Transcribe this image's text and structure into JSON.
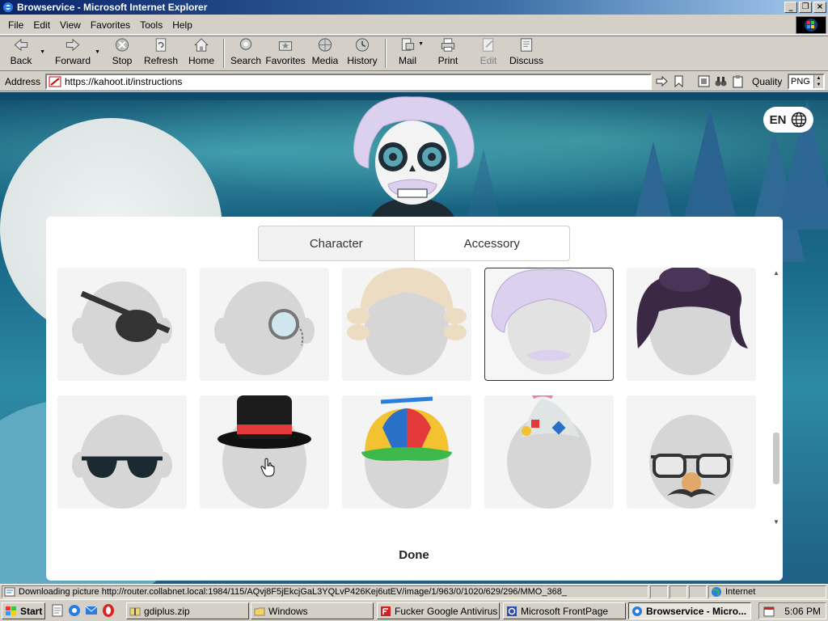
{
  "window": {
    "title": "Browservice - Microsoft Internet Explorer",
    "controls": {
      "minimize": "_",
      "maximize": "❐",
      "close": "×"
    }
  },
  "menu": [
    {
      "label": "File"
    },
    {
      "label": "Edit"
    },
    {
      "label": "View"
    },
    {
      "label": "Favorites"
    },
    {
      "label": "Tools"
    },
    {
      "label": "Help"
    }
  ],
  "toolbar": {
    "back": "Back",
    "forward": "Forward",
    "stop": "Stop",
    "refresh": "Refresh",
    "home": "Home",
    "search": "Search",
    "favorites": "Favorites",
    "media": "Media",
    "history": "History",
    "mail": "Mail",
    "print": "Print",
    "edit": "Edit",
    "discuss": "Discuss"
  },
  "address": {
    "label": "Address",
    "url": "https://kahoot.it/instructions",
    "quality_label": "Quality",
    "quality_value": "PNG"
  },
  "page": {
    "language": "EN",
    "tabs": [
      {
        "label": "Character",
        "active": true
      },
      {
        "label": "Accessory",
        "active": false
      }
    ],
    "accessories": [
      {
        "id": "eye-patch",
        "selected": false
      },
      {
        "id": "monocle",
        "selected": false
      },
      {
        "id": "powdered-wig",
        "selected": false
      },
      {
        "id": "einstein-hair",
        "selected": true
      },
      {
        "id": "pompadour-hair",
        "selected": false
      },
      {
        "id": "sunglasses",
        "selected": false
      },
      {
        "id": "top-hat",
        "selected": false
      },
      {
        "id": "propeller-cap",
        "selected": false
      },
      {
        "id": "party-hat",
        "selected": false
      },
      {
        "id": "groucho-glasses",
        "selected": false
      }
    ],
    "done_label": "Done",
    "colors": {
      "background_top": "#0f4a6a",
      "background_bottom": "#2d8aa5",
      "tree": "#2c6893",
      "panel": "#ffffff",
      "selected_border": "#333333"
    }
  },
  "status": {
    "text": "Downloading picture http://router.collabnet.local:1984/115/AQvj8F5jEkcjGaL3YQLvP426Kej6utEV/image/1/963/0/1020/629/296/MMO_368_",
    "zone": "Internet"
  },
  "taskbar": {
    "start": "Start",
    "tasks": [
      {
        "label": "gdiplus.zip",
        "active": false
      },
      {
        "label": "Windows",
        "active": false
      },
      {
        "label": "Fucker Google Antivirus ...",
        "active": false
      },
      {
        "label": "Microsoft FrontPage",
        "active": false
      },
      {
        "label": "Browservice - Micro...",
        "active": true
      }
    ],
    "clock": "5:06 PM"
  }
}
